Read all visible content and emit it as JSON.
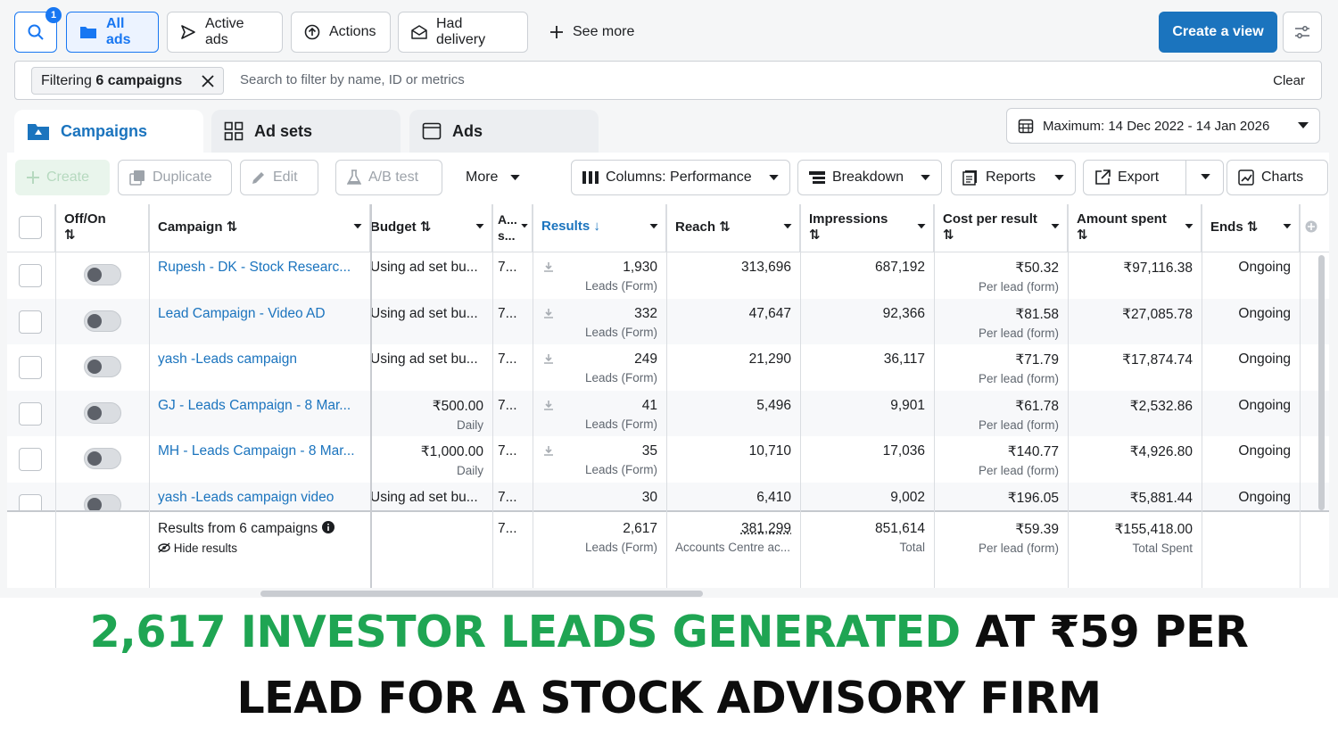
{
  "filters": {
    "search_badge": "1",
    "all_ads": "All ads",
    "active_ads": "Active ads",
    "actions": "Actions",
    "had_delivery": "Had delivery",
    "see_more": "See more",
    "create_view": "Create a view"
  },
  "search": {
    "chip_prefix": "Filtering",
    "chip_bold": "6 campaigns",
    "placeholder": "Search to filter by name, ID or metrics",
    "clear": "Clear"
  },
  "tabs": [
    {
      "label": "Campaigns",
      "active": true
    },
    {
      "label": "Ad sets",
      "active": false
    },
    {
      "label": "Ads",
      "active": false
    }
  ],
  "date_range": "Maximum: 14 Dec 2022 - 14 Jan 2026",
  "toolbar": {
    "create": "Create",
    "duplicate": "Duplicate",
    "edit": "Edit",
    "abtest": "A/B test",
    "more": "More",
    "columns": "Columns: Performance",
    "breakdown": "Breakdown",
    "reports": "Reports",
    "export": "Export",
    "charts": "Charts"
  },
  "table": {
    "headers": {
      "offon": "Off/On",
      "campaign": "Campaign",
      "budget": "Budget",
      "attr": "A... s...",
      "results": "Results",
      "reach": "Reach",
      "impressions": "Impressions",
      "cpr": "Cost per result",
      "spent": "Amount spent",
      "ends": "Ends"
    },
    "rows": [
      {
        "campaign": "Rupesh - DK - Stock Researc...",
        "budget": "Using ad set bu...",
        "budget_sub": "",
        "attr": "7...",
        "results": "1,930",
        "results_sub": "Leads (Form)",
        "reach": "313,696",
        "impressions": "687,192",
        "cpr": "₹50.32",
        "cpr_sub": "Per lead (form)",
        "spent": "₹97,116.38",
        "ends": "Ongoing"
      },
      {
        "campaign": "Lead Campaign - Video AD",
        "budget": "Using ad set bu...",
        "budget_sub": "",
        "attr": "7...",
        "results": "332",
        "results_sub": "Leads (Form)",
        "reach": "47,647",
        "impressions": "92,366",
        "cpr": "₹81.58",
        "cpr_sub": "Per lead (form)",
        "spent": "₹27,085.78",
        "ends": "Ongoing"
      },
      {
        "campaign": "yash -Leads campaign",
        "budget": "Using ad set bu...",
        "budget_sub": "",
        "attr": "7...",
        "results": "249",
        "results_sub": "Leads (Form)",
        "reach": "21,290",
        "impressions": "36,117",
        "cpr": "₹71.79",
        "cpr_sub": "Per lead (form)",
        "spent": "₹17,874.74",
        "ends": "Ongoing"
      },
      {
        "campaign": "GJ - Leads Campaign - 8 Mar...",
        "budget": "₹500.00",
        "budget_sub": "Daily",
        "attr": "7...",
        "results": "41",
        "results_sub": "Leads (Form)",
        "reach": "5,496",
        "impressions": "9,901",
        "cpr": "₹61.78",
        "cpr_sub": "Per lead (form)",
        "spent": "₹2,532.86",
        "ends": "Ongoing"
      },
      {
        "campaign": "MH - Leads Campaign - 8 Mar...",
        "budget": "₹1,000.00",
        "budget_sub": "Daily",
        "attr": "7...",
        "results": "35",
        "results_sub": "Leads (Form)",
        "reach": "10,710",
        "impressions": "17,036",
        "cpr": "₹140.77",
        "cpr_sub": "Per lead (form)",
        "spent": "₹4,926.80",
        "ends": "Ongoing"
      },
      {
        "campaign": "yash -Leads campaign video",
        "budget": "Using ad set bu...",
        "budget_sub": "",
        "attr": "7...",
        "results": "30",
        "results_sub": "",
        "reach": "6,410",
        "impressions": "9,002",
        "cpr": "₹196.05",
        "cpr_sub": "",
        "spent": "₹5,881.44",
        "ends": "Ongoing"
      }
    ],
    "totals": {
      "label": "Results from 6 campaigns",
      "hide": "Hide results",
      "attr": "7...",
      "results": "2,617",
      "results_sub": "Leads (Form)",
      "reach": "381,299",
      "reach_sub": "Accounts Centre ac...",
      "impressions": "851,614",
      "impressions_sub": "Total",
      "cpr": "₹59.39",
      "cpr_sub": "Per lead (form)",
      "spent": "₹155,418.00",
      "spent_sub": "Total Spent"
    }
  },
  "caption": {
    "highlight": "2,617 INVESTOR LEADS GENERATED",
    "rest_line1": " AT ₹59 PER",
    "line2": "LEAD FOR A STOCK ADVISORY FIRM"
  },
  "colors": {
    "accent": "#1b74be",
    "highlight_green": "#1fa553"
  }
}
